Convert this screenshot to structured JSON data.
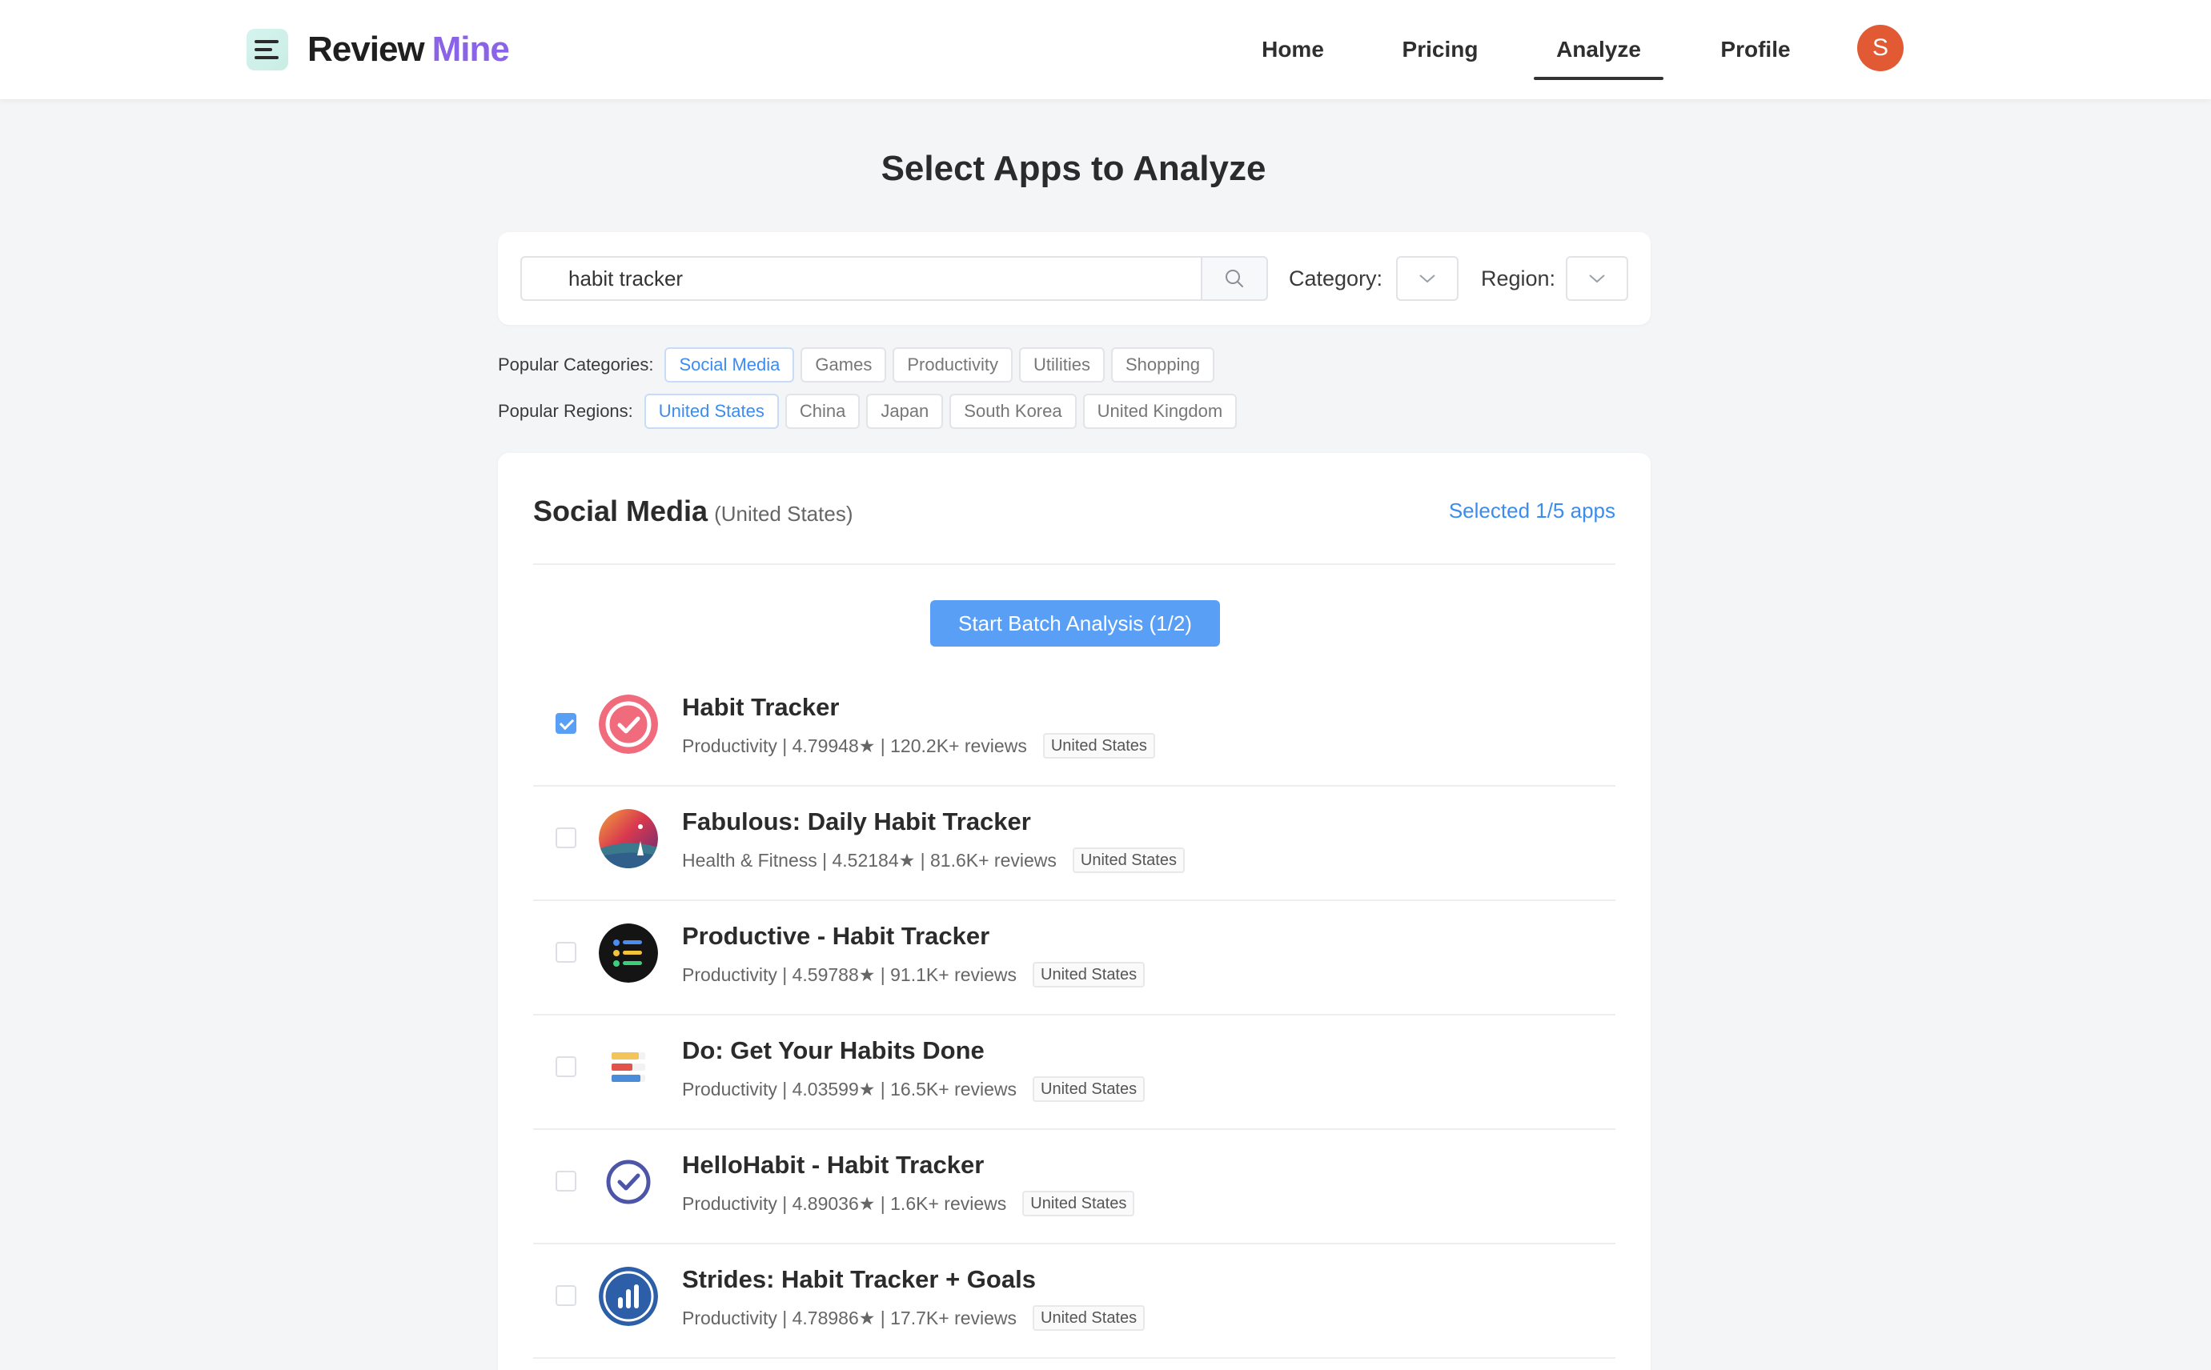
{
  "header": {
    "logo_word1": "Review",
    "logo_word2": "Mine",
    "nav": {
      "home": "Home",
      "pricing": "Pricing",
      "analyze": "Analyze",
      "profile": "Profile"
    },
    "avatar_initial": "S",
    "active_nav": "Analyze"
  },
  "page": {
    "title": "Select Apps to Analyze"
  },
  "search": {
    "value": "habit tracker",
    "category_label": "Category:",
    "region_label": "Region:"
  },
  "popular": {
    "categories_label": "Popular Categories:",
    "categories": [
      "Social Media",
      "Games",
      "Productivity",
      "Utilities",
      "Shopping"
    ],
    "active_category": "Social Media",
    "regions_label": "Popular Regions:",
    "regions": [
      "United States",
      "China",
      "Japan",
      "South Korea",
      "United Kingdom"
    ],
    "active_region": "United States"
  },
  "results": {
    "category": "Social Media",
    "region": "(United States)",
    "selected_text": "Selected 1/5 apps",
    "batch_button": "Start Batch Analysis (1/2)",
    "apps": [
      {
        "name": "Habit Tracker",
        "meta": "Productivity | 4.79948★ | 120.2K+ reviews",
        "region": "United States",
        "checked": true
      },
      {
        "name": "Fabulous: Daily Habit Tracker",
        "meta": "Health & Fitness | 4.52184★ | 81.6K+ reviews",
        "region": "United States",
        "checked": false
      },
      {
        "name": "Productive - Habit Tracker",
        "meta": "Productivity | 4.59788★ | 91.1K+ reviews",
        "region": "United States",
        "checked": false
      },
      {
        "name": "Do: Get Your Habits Done",
        "meta": "Productivity | 4.03599★ | 16.5K+ reviews",
        "region": "United States",
        "checked": false
      },
      {
        "name": "HelloHabit - Habit Tracker",
        "meta": "Productivity | 4.89036★ | 1.6K+ reviews",
        "region": "United States",
        "checked": false
      },
      {
        "name": "Strides: Habit Tracker + Goals",
        "meta": "Productivity | 4.78986★ | 17.7K+ reviews",
        "region": "United States",
        "checked": false
      }
    ]
  },
  "colors": {
    "accent": "#3b8cf0",
    "button": "#5a9ff6",
    "logo_accent": "#8b63e6",
    "avatar": "#e25a33"
  }
}
